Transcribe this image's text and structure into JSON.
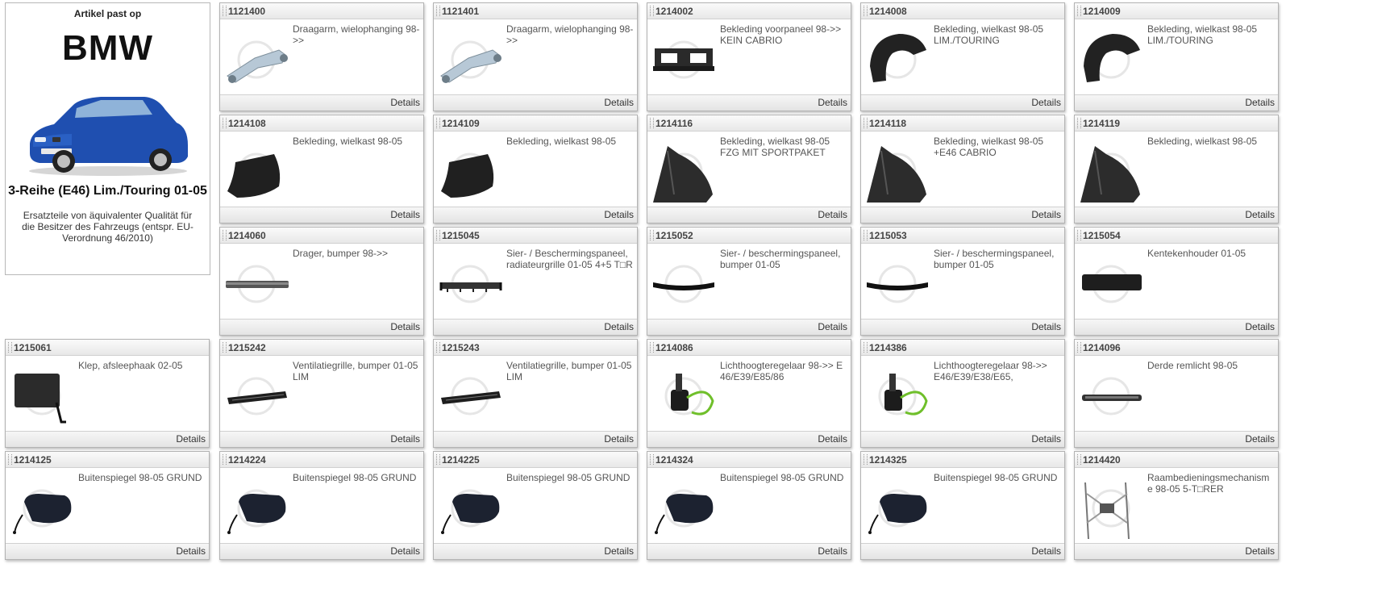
{
  "vehicle": {
    "heading": "Artikel past op",
    "brand": "BMW",
    "image": "blue-bmw-sedan-image",
    "model": "3-Reihe (E46) Lim./Touring 01-05",
    "description": "Ersatzteile von äquivalenter Qualität für die Besitzer des Fahrzeugs (entspr. EU-Verordnung 46/2010)"
  },
  "details_label": "Details",
  "products": [
    {
      "code": "1121400",
      "desc": "Draagarm, wielophanging 98->>",
      "icon": "control-arm"
    },
    {
      "code": "1121401",
      "desc": "Draagarm, wielophanging 98->>",
      "icon": "control-arm"
    },
    {
      "code": "1214002",
      "desc": "Bekleding voorpaneel 98->> KEIN CABRIO",
      "icon": "front-panel"
    },
    {
      "code": "1214008",
      "desc": "Bekleding, wielkast 98-05 LIM./TOURING",
      "icon": "wheel-liner"
    },
    {
      "code": "1214009",
      "desc": "Bekleding, wielkast 98-05 LIM./TOURING",
      "icon": "wheel-liner"
    },
    {
      "code": "1214108",
      "desc": "Bekleding, wielkast 98-05",
      "icon": "wheel-liner-flat"
    },
    {
      "code": "1214109",
      "desc": "Bekleding, wielkast 98-05",
      "icon": "wheel-liner-flat"
    },
    {
      "code": "1214116",
      "desc": "Bekleding, wielkast 98-05 FZG MIT SPORTPAKET",
      "icon": "wheel-liner-large"
    },
    {
      "code": "1214118",
      "desc": "Bekleding, wielkast 98-05 +E46 CABRIO",
      "icon": "wheel-liner-large"
    },
    {
      "code": "1214119",
      "desc": "Bekleding, wielkast 98-05",
      "icon": "wheel-liner-large"
    },
    {
      "code": "1214060",
      "desc": "Drager, bumper 98->>",
      "icon": "bumper-bar"
    },
    {
      "code": "1215045",
      "desc": "Sier- / Beschermingspaneel, radiateurgrille 01-05 4+5 T□R",
      "icon": "grille-panel"
    },
    {
      "code": "1215052",
      "desc": "Sier- / beschermingspaneel, bumper 01-05",
      "icon": "bumper-strip"
    },
    {
      "code": "1215053",
      "desc": "Sier- / beschermingspaneel, bumper 01-05",
      "icon": "bumper-strip"
    },
    {
      "code": "1215054",
      "desc": "Kentekenhouder 01-05",
      "icon": "plate-holder"
    },
    {
      "code": "1215061",
      "desc": "Klep, afsleephaak 02-05",
      "icon": "tow-cover"
    },
    {
      "code": "1215242",
      "desc": "Ventilatiegrille, bumper 01-05 LIM",
      "icon": "vent-grille"
    },
    {
      "code": "1215243",
      "desc": "Ventilatiegrille, bumper 01-05 LIM",
      "icon": "vent-grille"
    },
    {
      "code": "1214086",
      "desc": "Lichthoogteregelaar 98->> E 46/E39/E85/86",
      "icon": "level-motor"
    },
    {
      "code": "1214386",
      "desc": "Lichthoogteregelaar 98->> E46/E39/E38/E65,",
      "icon": "level-motor"
    },
    {
      "code": "1214096",
      "desc": "Derde remlicht 98-05",
      "icon": "brake-light"
    },
    {
      "code": "1214125",
      "desc": "Buitenspiegel 98-05 GRUND",
      "icon": "mirror"
    },
    {
      "code": "1214224",
      "desc": "Buitenspiegel 98-05 GRUND",
      "icon": "mirror"
    },
    {
      "code": "1214225",
      "desc": "Buitenspiegel 98-05 GRUND",
      "icon": "mirror"
    },
    {
      "code": "1214324",
      "desc": "Buitenspiegel 98-05 GRUND",
      "icon": "mirror"
    },
    {
      "code": "1214325",
      "desc": "Buitenspiegel 98-05 GRUND",
      "icon": "mirror"
    },
    {
      "code": "1214420",
      "desc": "Raambedieningsmechanisme 98-05 5-T□RER",
      "icon": "window-regulator"
    }
  ]
}
